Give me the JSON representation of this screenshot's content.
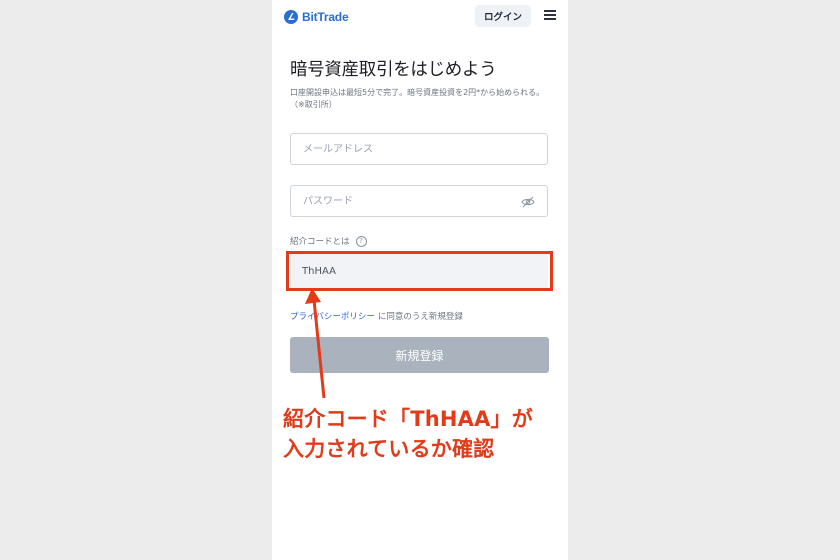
{
  "header": {
    "logo_text": "BitTrade",
    "login_label": "ログイン",
    "menu_icon": "hamburger-menu-icon"
  },
  "main": {
    "title": "暗号資産取引をはじめよう",
    "subtitle": "口座開設申込は最短5分で完了。暗号資産投資を2円*から始められる。（※取引所）",
    "email_placeholder": "メールアドレス",
    "password_placeholder": "パスワード",
    "password_icon": "eye-slash-icon",
    "referral_label": "紹介コードとは",
    "referral_help_icon": "?",
    "referral_value": "ThHAA",
    "privacy_link": "プライバシーポリシー",
    "privacy_rest": "に同意のうえ新規登録",
    "register_label": "新規登録"
  },
  "annotation": {
    "line1": "紹介コード「ThHAA」が",
    "line2": "入力されているか確認",
    "color": "#e23b1c"
  },
  "colors": {
    "brand": "#2a6fd0",
    "link": "#2f64c9",
    "button_disabled": "#a9b2bd",
    "highlight": "#e23b1c"
  }
}
